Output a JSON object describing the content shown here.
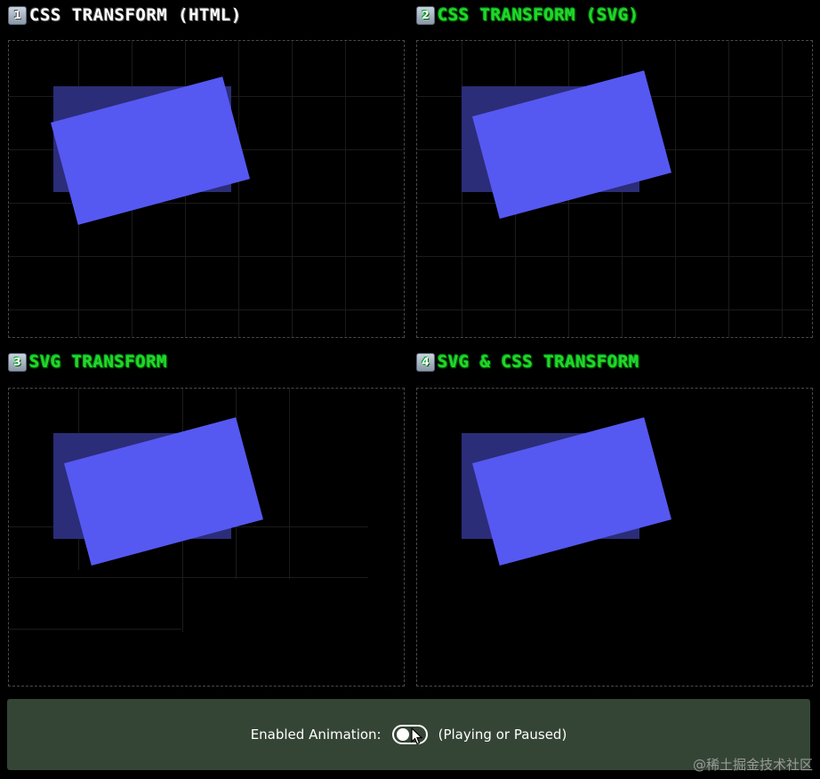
{
  "panels": [
    {
      "number": "1",
      "title": "CSS Transform (HTML)",
      "title_color": "#ffffff"
    },
    {
      "number": "2",
      "title": "CSS Transform (SVG)",
      "title_color": "#25d625"
    },
    {
      "number": "3",
      "title": "SVG Transform",
      "title_color": "#25d625"
    },
    {
      "number": "4",
      "title": "SVG & CSS Transform",
      "title_color": "#25d625"
    }
  ],
  "colors": {
    "base_rect": "#2b2d78",
    "moving_rect": "#5658f2",
    "footer_bg": "#354535"
  },
  "footer": {
    "label": "Enabled Animation:",
    "status": "(Playing or Paused)",
    "toggle_on": false
  },
  "watermark": "@稀土掘金技术社区"
}
